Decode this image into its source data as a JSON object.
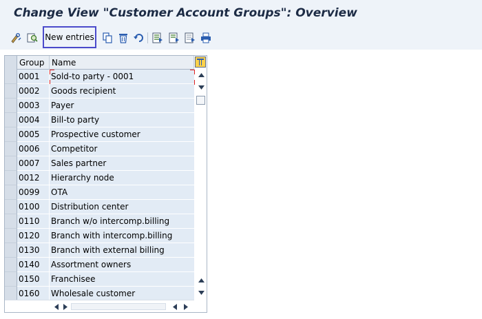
{
  "window": {
    "title": "Change View \"Customer Account Groups\": Overview"
  },
  "toolbar": {
    "new_entries_label": "New entries",
    "icons": [
      "display-change-icon",
      "find-icon",
      "copy-icon",
      "delete-icon",
      "undo-icon",
      "select-all-icon",
      "select-block-icon",
      "deselect-all-icon",
      "print-icon"
    ]
  },
  "table": {
    "columns": [
      "Group",
      "Name"
    ],
    "rows": [
      {
        "group": "0001",
        "name": "Sold-to party - 0001"
      },
      {
        "group": "0002",
        "name": "Goods recipient"
      },
      {
        "group": "0003",
        "name": "Payer"
      },
      {
        "group": "0004",
        "name": "Bill-to party"
      },
      {
        "group": "0005",
        "name": "Prospective customer"
      },
      {
        "group": "0006",
        "name": "Competitor"
      },
      {
        "group": "0007",
        "name": "Sales partner"
      },
      {
        "group": "0012",
        "name": "Hierarchy node"
      },
      {
        "group": "0099",
        "name": "OTA"
      },
      {
        "group": "0100",
        "name": "Distribution center"
      },
      {
        "group": "0110",
        "name": "Branch w/o intercomp.billing"
      },
      {
        "group": "0120",
        "name": "Branch with intercomp.billing"
      },
      {
        "group": "0130",
        "name": "Branch with external billing"
      },
      {
        "group": "0140",
        "name": "Assortment owners"
      },
      {
        "group": "0150",
        "name": "Franchisee"
      },
      {
        "group": "0160",
        "name": "Wholesale customer"
      }
    ]
  },
  "colors": {
    "title_bar": "#eef3f9",
    "title_text": "#1c2b45",
    "cell_background": "#e2ebf5",
    "highlight_border": "#4a4acb",
    "focus_marker": "#e02020"
  }
}
